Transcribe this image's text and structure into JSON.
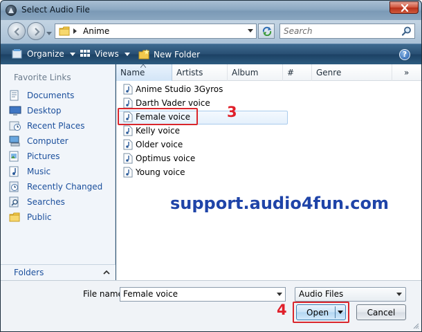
{
  "window": {
    "title": "Select Audio File"
  },
  "address": {
    "path_segment": "Anime",
    "search_placeholder": "Search"
  },
  "toolbar": {
    "organize_label": "Organize",
    "views_label": "Views",
    "new_folder_label": "New Folder",
    "help_label": "?"
  },
  "nav": {
    "heading": "Favorite Links",
    "items": [
      {
        "label": "Documents",
        "icon": "documents-icon"
      },
      {
        "label": "Desktop",
        "icon": "desktop-icon"
      },
      {
        "label": "Recent Places",
        "icon": "recent-places-icon"
      },
      {
        "label": "Computer",
        "icon": "computer-icon"
      },
      {
        "label": "Pictures",
        "icon": "pictures-icon"
      },
      {
        "label": "Music",
        "icon": "music-icon"
      },
      {
        "label": "Recently Changed",
        "icon": "recently-changed-icon"
      },
      {
        "label": "Searches",
        "icon": "searches-icon"
      },
      {
        "label": "Public",
        "icon": "public-folder-icon"
      }
    ],
    "folders_label": "Folders"
  },
  "columns": {
    "name": "Name",
    "artists": "Artists",
    "album": "Album",
    "number": "#",
    "genre": "Genre",
    "more": "»"
  },
  "files": [
    {
      "name": "Anime Studio 3Gyros",
      "selected": false
    },
    {
      "name": "Darth Vader voice",
      "selected": false
    },
    {
      "name": "Female voice",
      "selected": true
    },
    {
      "name": "Kelly voice",
      "selected": false
    },
    {
      "name": "Older voice",
      "selected": false
    },
    {
      "name": "Optimus voice",
      "selected": false
    },
    {
      "name": "Young voice",
      "selected": false
    }
  ],
  "annotations": {
    "step_3": "3",
    "step_4": "4",
    "watermark": "support.audio4fun.com"
  },
  "bottom": {
    "filename_label": "File name:",
    "filename_value": "Female voice",
    "filetype_value": "Audio Files",
    "open_label": "Open",
    "cancel_label": "Cancel"
  },
  "colors": {
    "annotation_red": "#e01f2a",
    "watermark_blue": "#1f44a8",
    "link_blue": "#1b4f9c",
    "toolbar_blue": "#284f73"
  }
}
